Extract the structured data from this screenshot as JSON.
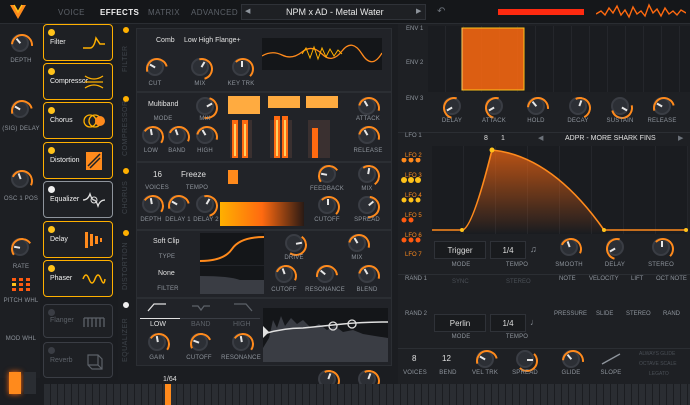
{
  "top_tabs": [
    "VOICE",
    "EFFECTS",
    "MATRIX",
    "ADVANCED"
  ],
  "preset": {
    "prev": "◀",
    "name": "NPM x AD - Metal Water",
    "next": "▶"
  },
  "left_macros": [
    "DEPTH",
    "(SIG) DELAY",
    "OSC 1 POS",
    "RATE",
    "PITCH WHL",
    "MOD WHL"
  ],
  "effects": [
    {
      "name": "Filter",
      "on": true
    },
    {
      "name": "Compressor",
      "on": true
    },
    {
      "name": "Chorus",
      "on": true
    },
    {
      "name": "Distortion",
      "on": true
    },
    {
      "name": "Equalizer",
      "on": true
    },
    {
      "name": "Delay",
      "on": true
    },
    {
      "name": "Phaser",
      "on": true
    },
    {
      "name": "Flanger",
      "on": false
    },
    {
      "name": "Reverb",
      "on": false
    }
  ],
  "section_titles": [
    "FILTER",
    "COMPRESSOR",
    "CHORUS",
    "DISTORTION",
    "EQUALIZER"
  ],
  "filter": {
    "type": "Comb",
    "model": "Low High Flange+",
    "knobs": [
      "CUT",
      "MIX",
      "KEY TRK"
    ]
  },
  "compressor": {
    "mode_value": "Multiband",
    "mode_label": "MODE",
    "mix": "MIX",
    "knobs": [
      "LOW",
      "BAND",
      "HIGH"
    ],
    "attack": "ATTACK",
    "release": "RELEASE"
  },
  "chorus": {
    "voices_value": "16",
    "voices_label": "VOICES",
    "tempo_value": "Freeze",
    "tempo_label": "TEMPO",
    "knobs": [
      "DEPTH",
      "DELAY 1",
      "DELAY 2"
    ],
    "feedback": "FEEDBACK",
    "mix": "MIX",
    "cutoff": "CUTOFF",
    "spread": "SPREAD"
  },
  "distortion": {
    "type_value": "Soft Clip",
    "type_label": "TYPE",
    "filter_value": "None",
    "filter_label": "FILTER",
    "drive": "DRIVE",
    "mix": "MIX",
    "cutoff": "CUTOFF",
    "resonance": "RESONANCE",
    "blend": "BLEND"
  },
  "equalizer": {
    "bands": [
      "LOW",
      "BAND",
      "HIGH"
    ],
    "knobs": [
      "GAIN",
      "CUTOFF",
      "RESONANCE"
    ]
  },
  "bottom_value": "1/64",
  "env": [
    "ENV 1",
    "ENV 2",
    "ENV 3"
  ],
  "env_knobs": [
    "DELAY",
    "ATTACK",
    "HOLD",
    "DECAY",
    "SUSTAIN",
    "RELEASE"
  ],
  "lfo_labels": [
    "LFO 1",
    "LFO 2",
    "LFO 3",
    "LFO 4",
    "LFO 5",
    "LFO 6",
    "LFO 7"
  ],
  "lfo": {
    "num_a": "8",
    "num_b": "1",
    "preset": "ADPR - MORE SHARK FINS",
    "mode_value": "Trigger",
    "mode_label": "MODE",
    "tempo_value": "1/4",
    "tempo_label": "TEMPO",
    "smooth": "SMOOTH",
    "delay": "DELAY",
    "stereo": "STEREO"
  },
  "rand": {
    "r1": "RAND 1",
    "r2": "RAND 2",
    "sync": "SYNC",
    "stereo": "STEREO",
    "mode_value": "Perlin",
    "mode_label": "MODE",
    "tempo_value": "1/4",
    "tempo_label": "TEMPO"
  },
  "mod_sources": [
    "NOTE",
    "VELOCITY",
    "LIFT",
    "OCT NOTE",
    "PRESSURE",
    "SLIDE",
    "STEREO",
    "RAND"
  ],
  "voice": {
    "voices_value": "8",
    "voices_label": "VOICES",
    "bend_value": "12",
    "bend_label": "BEND",
    "vel_trk": "VEL TRK",
    "spread": "SPREAD",
    "glide": "GLIDE",
    "slope": "SLOPE",
    "opts": [
      "ALWAYS GLIDE",
      "OCTAVE SCALE",
      "LEGATO"
    ]
  },
  "colors": {
    "accent": "#ff8a1c",
    "yellow": "#ffc21a",
    "red": "#ff3a0c"
  }
}
